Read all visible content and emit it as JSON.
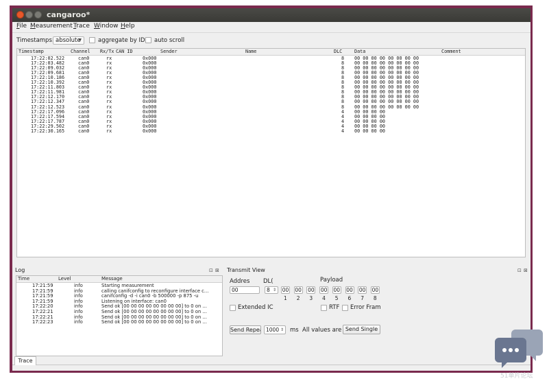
{
  "window": {
    "title": "cangaroo*"
  },
  "menu": [
    "File",
    "Measurement",
    "Trace",
    "Window",
    "Help"
  ],
  "toolbar": {
    "timestamps_label": "Timestamps:",
    "timestamps_value": "absolute",
    "aggregate_label": "aggregate by ID",
    "autoscroll_label": "auto scroll"
  },
  "trace": {
    "columns": [
      "Timestamp",
      "Channel",
      "Rx/Tx",
      "CAN ID",
      "Sender",
      "Name",
      "DLC",
      "Data",
      "Comment"
    ],
    "rows": [
      {
        "ts": "17:22:02.522",
        "ch": "can0",
        "dir": "rx",
        "id": "0x000",
        "dlc": "8",
        "data": "00 00 00 00 00 00 00 00"
      },
      {
        "ts": "17:22:03.482",
        "ch": "can0",
        "dir": "rx",
        "id": "0x000",
        "dlc": "8",
        "data": "00 00 00 00 00 00 00 00"
      },
      {
        "ts": "17:22:09.032",
        "ch": "can0",
        "dir": "rx",
        "id": "0x000",
        "dlc": "8",
        "data": "00 00 00 00 00 00 00 00"
      },
      {
        "ts": "17:22:09.681",
        "ch": "can0",
        "dir": "rx",
        "id": "0x000",
        "dlc": "8",
        "data": "00 00 00 00 00 00 00 00"
      },
      {
        "ts": "17:22:10.186",
        "ch": "can0",
        "dir": "rx",
        "id": "0x000",
        "dlc": "8",
        "data": "00 00 00 00 00 00 00 00"
      },
      {
        "ts": "17:22:10.392",
        "ch": "can0",
        "dir": "rx",
        "id": "0x000",
        "dlc": "8",
        "data": "00 00 00 00 00 00 00 00"
      },
      {
        "ts": "17:22:11.803",
        "ch": "can0",
        "dir": "rx",
        "id": "0x000",
        "dlc": "8",
        "data": "00 00 00 00 00 00 00 00"
      },
      {
        "ts": "17:22:11.981",
        "ch": "can0",
        "dir": "rx",
        "id": "0x000",
        "dlc": "8",
        "data": "00 00 00 00 00 00 00 00"
      },
      {
        "ts": "17:22:12.170",
        "ch": "can0",
        "dir": "rx",
        "id": "0x000",
        "dlc": "8",
        "data": "00 00 00 00 00 00 00 00"
      },
      {
        "ts": "17:22:12.347",
        "ch": "can0",
        "dir": "rx",
        "id": "0x000",
        "dlc": "8",
        "data": "00 00 00 00 00 00 00 00"
      },
      {
        "ts": "17:22:12.523",
        "ch": "can0",
        "dir": "rx",
        "id": "0x000",
        "dlc": "8",
        "data": "00 00 00 00 00 00 00 00"
      },
      {
        "ts": "17:22:17.096",
        "ch": "can0",
        "dir": "rx",
        "id": "0x000",
        "dlc": "4",
        "data": "00 00 00 00"
      },
      {
        "ts": "17:22:17.594",
        "ch": "can0",
        "dir": "rx",
        "id": "0x000",
        "dlc": "4",
        "data": "00 00 00 00"
      },
      {
        "ts": "17:22:17.787",
        "ch": "can0",
        "dir": "rx",
        "id": "0x000",
        "dlc": "4",
        "data": "00 00 00 00"
      },
      {
        "ts": "17:22:29.502",
        "ch": "can0",
        "dir": "rx",
        "id": "0x000",
        "dlc": "4",
        "data": "00 00 00 00"
      },
      {
        "ts": "17:22:30.165",
        "ch": "can0",
        "dir": "rx",
        "id": "0x000",
        "dlc": "4",
        "data": "00 00 00 00"
      }
    ]
  },
  "log": {
    "title": "Log",
    "columns": [
      "Time",
      "Level",
      "Message"
    ],
    "rows": [
      {
        "time": "17:21:59",
        "level": "info",
        "msg": "Starting measurement"
      },
      {
        "time": "17:21:59",
        "level": "info",
        "msg": "calling canifconfig to reconfigure interface c..."
      },
      {
        "time": "17:21:59",
        "level": "info",
        "msg": "canifconfig -d -i can0 -b 500000 -p 875 -u"
      },
      {
        "time": "17:21:59",
        "level": "info",
        "msg": "Listening on interface: can0"
      },
      {
        "time": "17:22:20",
        "level": "info",
        "msg": "Send ok [00 00 00 00 00 00 00 00] to 0 on ..."
      },
      {
        "time": "17:22:21",
        "level": "info",
        "msg": "Send ok [00 00 00 00 00 00 00 00] to 0 on ..."
      },
      {
        "time": "17:22:21",
        "level": "info",
        "msg": "Send ok [00 00 00 00 00 00 00 00] to 0 on ..."
      },
      {
        "time": "17:22:23",
        "level": "info",
        "msg": "Send ok [00 00 00 00 00 00 00 00] to 0 on ..."
      }
    ]
  },
  "transmit": {
    "title": "Transmit View",
    "address_label": "Addres",
    "dlc_label": "DL(",
    "payload_label": "Payload",
    "address_value": "00",
    "dlc_value": "8",
    "payload_bytes": [
      "00",
      "00",
      "00",
      "00",
      "00",
      "00",
      "00",
      "00"
    ],
    "payload_indices": [
      "1",
      "2",
      "3",
      "4",
      "5",
      "6",
      "7",
      "8"
    ],
    "extended_label": "Extended IC",
    "rtr_label": "RTF",
    "error_label": "Error Fram",
    "send_repeat_label": "Send Repea",
    "interval_value": "1000",
    "ms_label": "ms",
    "all_values_label": "All values are h",
    "send_single_label": "Send Single"
  },
  "tabs": {
    "trace": "Trace"
  },
  "panel_controls": {
    "float": "⊡",
    "close": "⊠"
  },
  "watermark": {
    "text": "51单片论坛"
  }
}
